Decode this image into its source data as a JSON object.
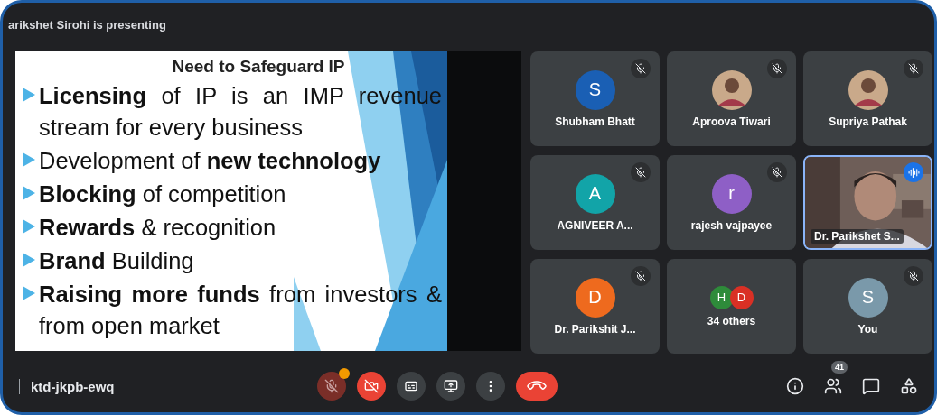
{
  "presenter_banner": "arikshet Sirohi is presenting",
  "slide": {
    "title": "Need to Safeguard IP",
    "bullets": [
      "**Licensing** of IP is an IMP revenue stream for every business",
      "Development of **new technology**",
      "**Blocking** of competition",
      "**Rewards** & recognition",
      "**Brand** Building",
      "**Raising more funds** from investors & from open market"
    ]
  },
  "tiles": [
    {
      "name": "Shubham Bhatt",
      "avatar": {
        "kind": "letter",
        "letter": "S",
        "color": "#1a5fb4"
      },
      "muted": true,
      "speaking": false
    },
    {
      "name": "Aproova Tiwari",
      "muted": true,
      "speaking": false
    },
    {
      "name": "Supriya Pathak",
      "muted": true,
      "speaking": false
    },
    {
      "name": "AGNIVEER A...",
      "avatar": {
        "kind": "letter",
        "letter": "A",
        "color": "#12a4a8"
      },
      "muted": true,
      "speaking": false
    },
    {
      "name": "rajesh vajpayee",
      "avatar": {
        "kind": "letter",
        "letter": "r",
        "color": "#8e5fc6"
      },
      "muted": true,
      "speaking": false
    },
    {
      "name": "Dr. Parikshet S...",
      "avatar": {
        "kind": "video"
      },
      "muted": false,
      "speaking": true
    },
    {
      "name": "Dr. Parikshit J...",
      "avatar": {
        "kind": "letter",
        "letter": "D",
        "color": "#ee6a1e"
      },
      "muted": true,
      "speaking": false
    },
    {
      "name": "34 others",
      "avatar": {
        "kind": "group",
        "letters": [
          {
            "letter": "H",
            "color": "#2e8b3a"
          },
          {
            "letter": "D",
            "color": "#d93025"
          }
        ]
      },
      "muted": false,
      "speaking": false
    },
    {
      "name": "You",
      "avatar": {
        "kind": "letter",
        "letter": "S",
        "color": "#7a99aa"
      },
      "muted": true,
      "speaking": false
    }
  ],
  "meeting_code": "ktd-jkpb-ewq",
  "controls": [
    {
      "kind": "mic",
      "on": false,
      "alert": true
    },
    {
      "kind": "camera",
      "on": false
    },
    {
      "kind": "captions"
    },
    {
      "kind": "present"
    },
    {
      "kind": "more"
    },
    {
      "kind": "leave"
    }
  ],
  "side_buttons": [
    {
      "kind": "info"
    },
    {
      "kind": "people",
      "badge": "41"
    },
    {
      "kind": "chat"
    },
    {
      "kind": "activities"
    }
  ]
}
